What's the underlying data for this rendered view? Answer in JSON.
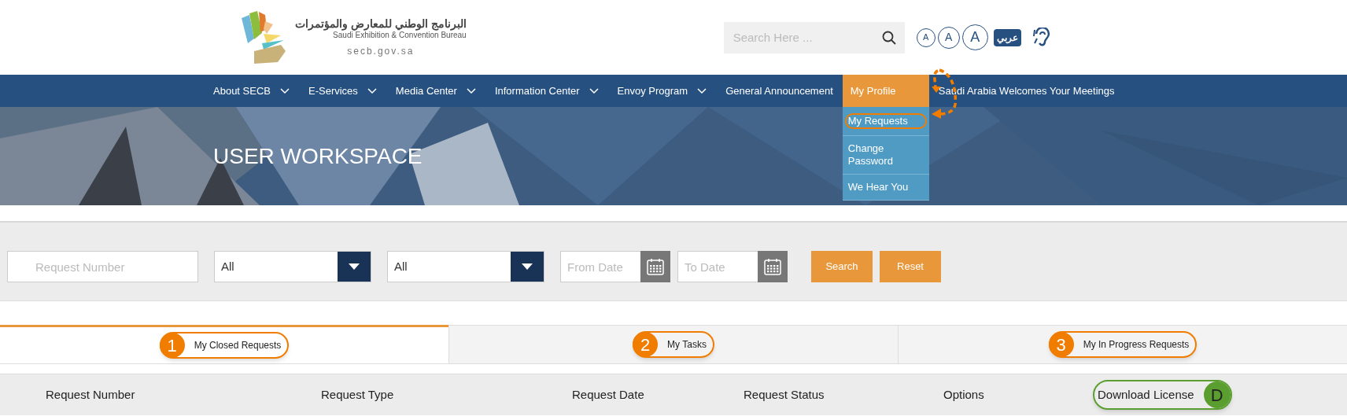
{
  "header": {
    "logo": {
      "arabic": "البرنامج الوطني للمعارض والمؤتمرات",
      "english": "Saudi Exhibition & Convention Bureau",
      "domain": "secb.gov.sa"
    },
    "search": {
      "placeholder": "Search Here ..."
    },
    "font_sizes": [
      "A",
      "A",
      "A"
    ],
    "language": "عربي"
  },
  "nav": [
    {
      "label": "About SECB",
      "has_menu": true,
      "selected": false
    },
    {
      "label": "E-Services",
      "has_menu": true,
      "selected": false
    },
    {
      "label": "Media Center",
      "has_menu": true,
      "selected": false
    },
    {
      "label": "Information Center",
      "has_menu": true,
      "selected": false
    },
    {
      "label": "Envoy Program",
      "has_menu": true,
      "selected": false
    },
    {
      "label": "General Announcement",
      "has_menu": false,
      "selected": false
    },
    {
      "label": "My Profile",
      "has_menu": false,
      "selected": true
    },
    {
      "label": "Saudi Arabia Welcomes Your Meetings",
      "has_menu": false,
      "selected": false
    }
  ],
  "profile_menu": [
    {
      "label": "My Requests",
      "annotated": true
    },
    {
      "label": "Change Password",
      "annotated": false
    },
    {
      "label": "We Hear You",
      "annotated": false
    }
  ],
  "banner": {
    "title": "USER WORKSPACE"
  },
  "filters": [
    {
      "kind": "text",
      "placeholder": "Request Number"
    },
    {
      "kind": "select",
      "value": "All"
    },
    {
      "kind": "select",
      "value": "All"
    },
    {
      "kind": "date",
      "placeholder": "From Date"
    },
    {
      "kind": "date",
      "placeholder": "To Date"
    }
  ],
  "buttons": [
    "Search",
    "Reset"
  ],
  "tabs": [
    {
      "label": "My Closed Requests",
      "badge": "1",
      "selected": true
    },
    {
      "label": "My Tasks",
      "badge": "2",
      "selected": false
    },
    {
      "label": "My In Progress Requests",
      "badge": "3",
      "selected": false
    }
  ],
  "columns": [
    {
      "label": "Request Number"
    },
    {
      "label": "Request Type"
    },
    {
      "label": "Request Date"
    },
    {
      "label": "Request Status"
    },
    {
      "label": "Options"
    },
    {
      "label": "Download License",
      "badge": "D",
      "color": "#5a9e2f"
    }
  ]
}
